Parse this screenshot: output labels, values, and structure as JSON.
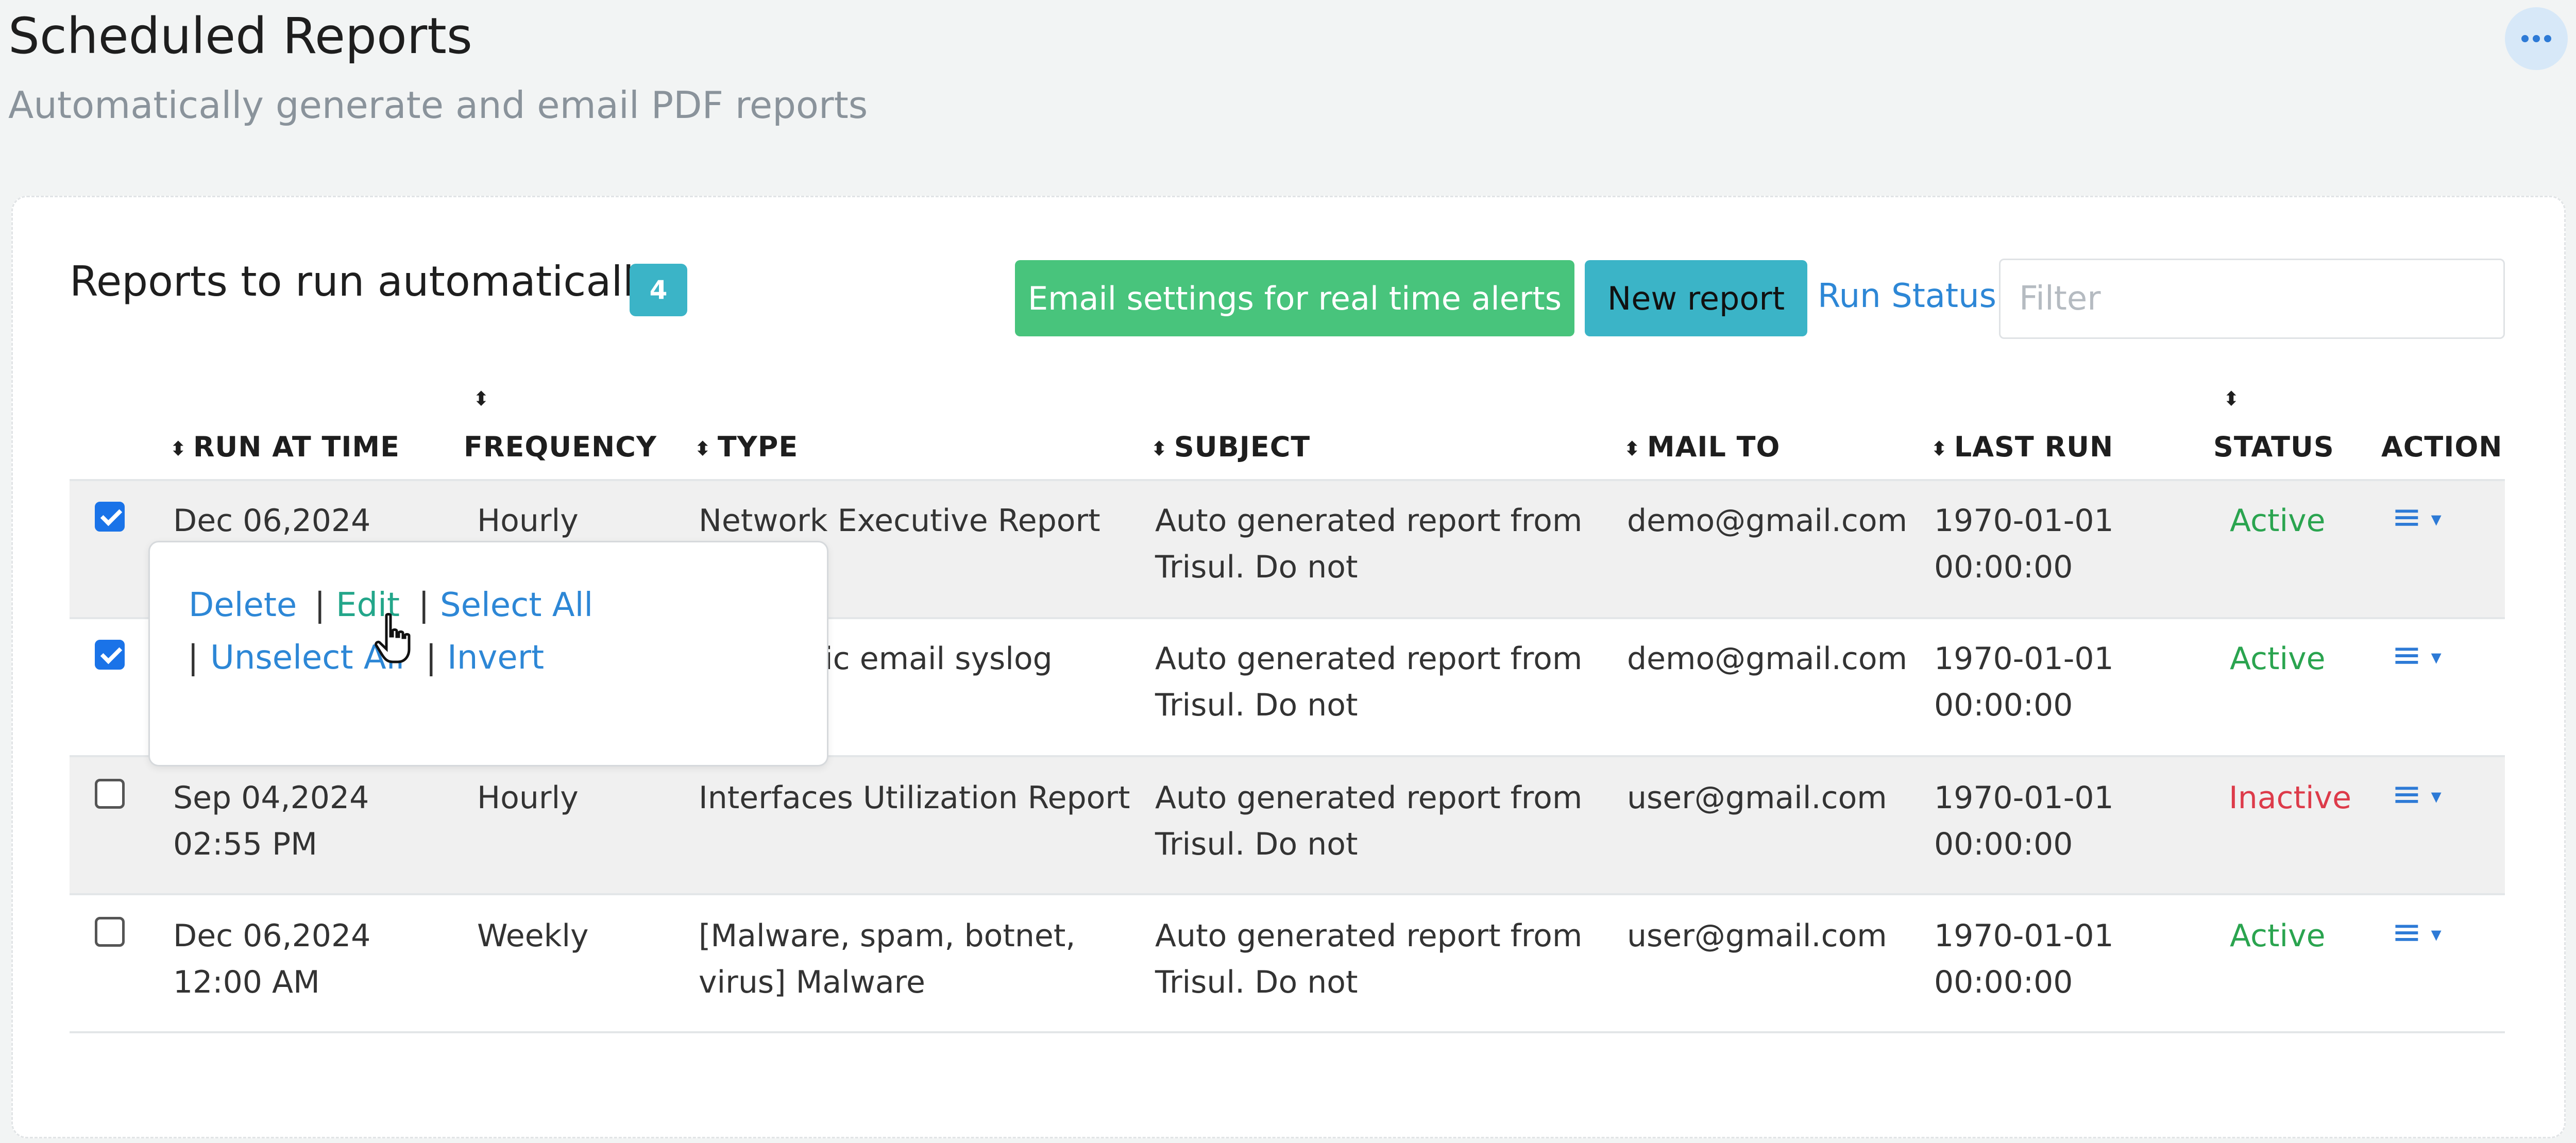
{
  "header": {
    "title": "Scheduled Reports",
    "subtitle": "Automatically generate and email PDF reports"
  },
  "card": {
    "title": "Reports to run automatically",
    "count": "4",
    "email_settings_label": "Email settings for real time alerts",
    "new_report_label": "New report",
    "run_status_label": "Run Status",
    "filter_placeholder": "Filter"
  },
  "table": {
    "columns": [
      "RUN AT TIME",
      "FREQUENCY",
      "TYPE",
      "SUBJECT",
      "MAIL TO",
      "LAST RUN",
      "STATUS",
      "ACTION"
    ],
    "rows": [
      {
        "checked": true,
        "run_date": "Dec 06,2024",
        "run_time": "",
        "frequency": "Hourly",
        "type1": "Network Executive Report",
        "type2": "",
        "subject1": "Auto generated report from",
        "subject2": "Trisul. Do not",
        "mail_to": "demo@gmail.com",
        "last_run1": "1970-01-01",
        "last_run2": "00:00:00",
        "status": "Active"
      },
      {
        "checked": true,
        "run_date": "",
        "run_time": "",
        "frequency": "",
        "type1": "ic email syslog",
        "type2": "",
        "subject1": "Auto generated report from",
        "subject2": "Trisul. Do not",
        "mail_to": "demo@gmail.com",
        "last_run1": "1970-01-01",
        "last_run2": "00:00:00",
        "status": "Active"
      },
      {
        "checked": false,
        "run_date": "Sep 04,2024",
        "run_time": "02:55 PM",
        "frequency": "Hourly",
        "type1": "Interfaces Utilization Report",
        "type2": "",
        "subject1": "Auto generated report from",
        "subject2": "Trisul. Do not",
        "mail_to": "user@gmail.com",
        "last_run1": "1970-01-01",
        "last_run2": "00:00:00",
        "status": "Inactive"
      },
      {
        "checked": false,
        "run_date": "Dec 06,2024",
        "run_time": "12:00 AM",
        "frequency": "Weekly",
        "type1": "[Malware, spam, botnet,",
        "type2": "virus] Malware",
        "subject1": "Auto generated report from",
        "subject2": "Trisul. Do not",
        "mail_to": "user@gmail.com",
        "last_run1": "1970-01-01",
        "last_run2": "00:00:00",
        "status": "Active"
      }
    ]
  },
  "popover": {
    "delete": "Delete",
    "edit": "Edit",
    "select_all": "Select All",
    "unselect_all": "Unselect All",
    "invert": "Invert",
    "separator": "|"
  },
  "icons": {
    "more": "ellipsis-icon",
    "sort": "sort-icon",
    "action": "hamburger-menu-icon",
    "cursor": "hand-pointer-icon"
  },
  "colors": {
    "green_button": "#48c47c",
    "teal_button": "#3bb4c7",
    "link": "#2d87d6",
    "active": "#2aa44f",
    "inactive": "#dd3b4a"
  }
}
